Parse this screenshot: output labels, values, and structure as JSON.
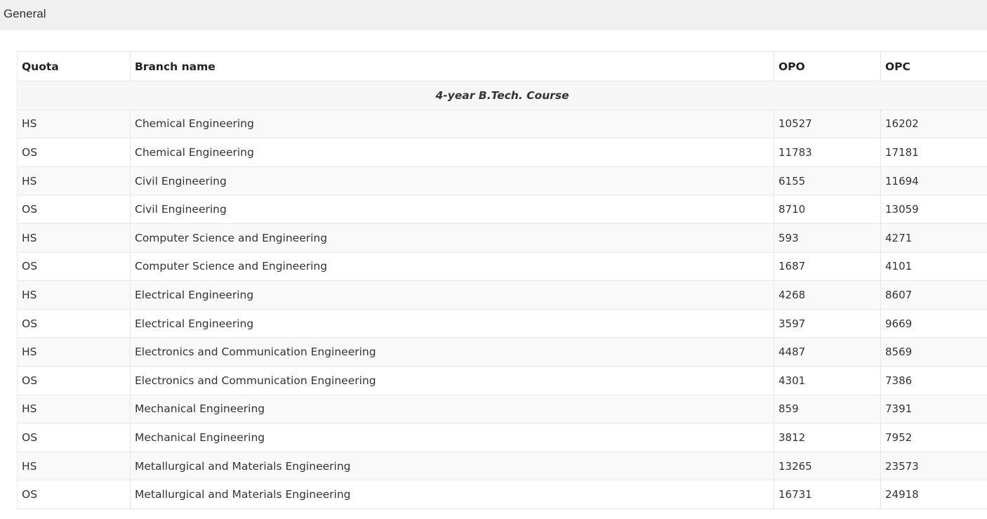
{
  "panel": {
    "title": "General"
  },
  "table": {
    "headers": {
      "quota": "Quota",
      "branch": "Branch name",
      "opo": "OPO",
      "opc": "OPC"
    },
    "group_label": "4-year B.Tech. Course",
    "rows": [
      {
        "quota": "HS",
        "branch": "Chemical Engineering",
        "opo": "10527",
        "opc": "16202"
      },
      {
        "quota": "OS",
        "branch": "Chemical Engineering",
        "opo": "11783",
        "opc": "17181"
      },
      {
        "quota": "HS",
        "branch": "Civil Engineering",
        "opo": "6155",
        "opc": "11694"
      },
      {
        "quota": "OS",
        "branch": "Civil Engineering",
        "opo": "8710",
        "opc": "13059"
      },
      {
        "quota": "HS",
        "branch": "Computer Science and Engineering",
        "opo": "593",
        "opc": "4271"
      },
      {
        "quota": "OS",
        "branch": "Computer Science and Engineering",
        "opo": "1687",
        "opc": "4101"
      },
      {
        "quota": "HS",
        "branch": "Electrical Engineering",
        "opo": "4268",
        "opc": "8607"
      },
      {
        "quota": "OS",
        "branch": "Electrical Engineering",
        "opo": "3597",
        "opc": "9669"
      },
      {
        "quota": "HS",
        "branch": "Electronics and Communication Engineering",
        "opo": "4487",
        "opc": "8569"
      },
      {
        "quota": "OS",
        "branch": "Electronics and Communication Engineering",
        "opo": "4301",
        "opc": "7386"
      },
      {
        "quota": "HS",
        "branch": "Mechanical Engineering",
        "opo": "859",
        "opc": "7391"
      },
      {
        "quota": "OS",
        "branch": "Mechanical Engineering",
        "opo": "3812",
        "opc": "7952"
      },
      {
        "quota": "HS",
        "branch": "Metallurgical and Materials Engineering",
        "opo": "13265",
        "opc": "23573"
      },
      {
        "quota": "OS",
        "branch": "Metallurgical and Materials Engineering",
        "opo": "16731",
        "opc": "24918"
      }
    ]
  }
}
